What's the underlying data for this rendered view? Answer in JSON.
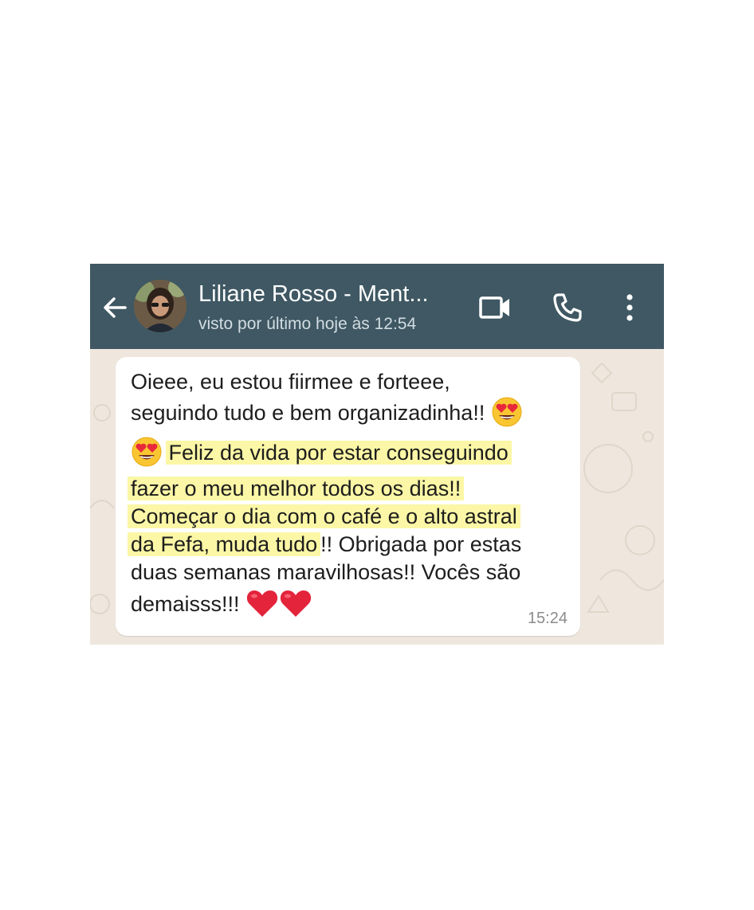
{
  "header": {
    "contact_name": "Liliane Rosso - Ment...",
    "last_seen": "visto por último hoje às 12:54",
    "color": "#3f5863"
  },
  "icons": {
    "back": "arrow-left-icon",
    "video": "video-call-icon",
    "call": "phone-icon",
    "menu": "more-vert-icon",
    "emoji_face": "heart-eyes-emoji",
    "emoji_heart": "red-heart-emoji"
  },
  "message": {
    "line1": "Oieee, eu estou fiirmee e forteee,",
    "line2": "seguindo tudo e bem organizadinha!!",
    "line3": "Feliz da vida por estar conseguindo",
    "line4": "fazer o meu melhor todos os dias!!",
    "line5": "Começar o dia com o café e o alto astral",
    "line6a": "da Fefa, muda tudo",
    "line6b": "!! Obrigada por estas",
    "line7": "duas semanas maravilhosas!! Vocês são",
    "line8": "demaisss!!!",
    "time": "15:24",
    "highlight_color": "#fbf7a6"
  }
}
